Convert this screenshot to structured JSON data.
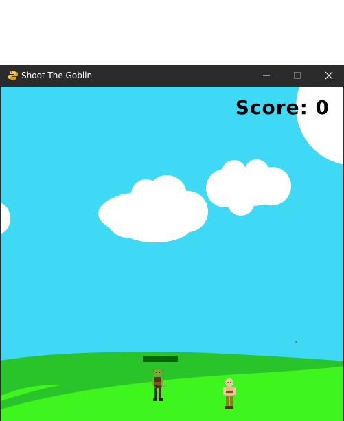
{
  "window": {
    "title": "Shoot The Goblin",
    "app_icon": "python-icon",
    "controls": {
      "minimize_icon": "minimize-icon",
      "maximize_icon": "maximize-icon",
      "close_icon": "close-icon"
    }
  },
  "hud": {
    "score_label": "Score: 0"
  },
  "colors": {
    "sky": "#3fd9f5",
    "hill_back": "#28c42a",
    "hill_front": "#3ef51e",
    "cloud": "#ffffff",
    "health_bar": "#006b00",
    "titlebar": "#2b2b2b"
  },
  "sprites": {
    "goblin_icon": "goblin-icon",
    "player_icon": "player-icon"
  }
}
